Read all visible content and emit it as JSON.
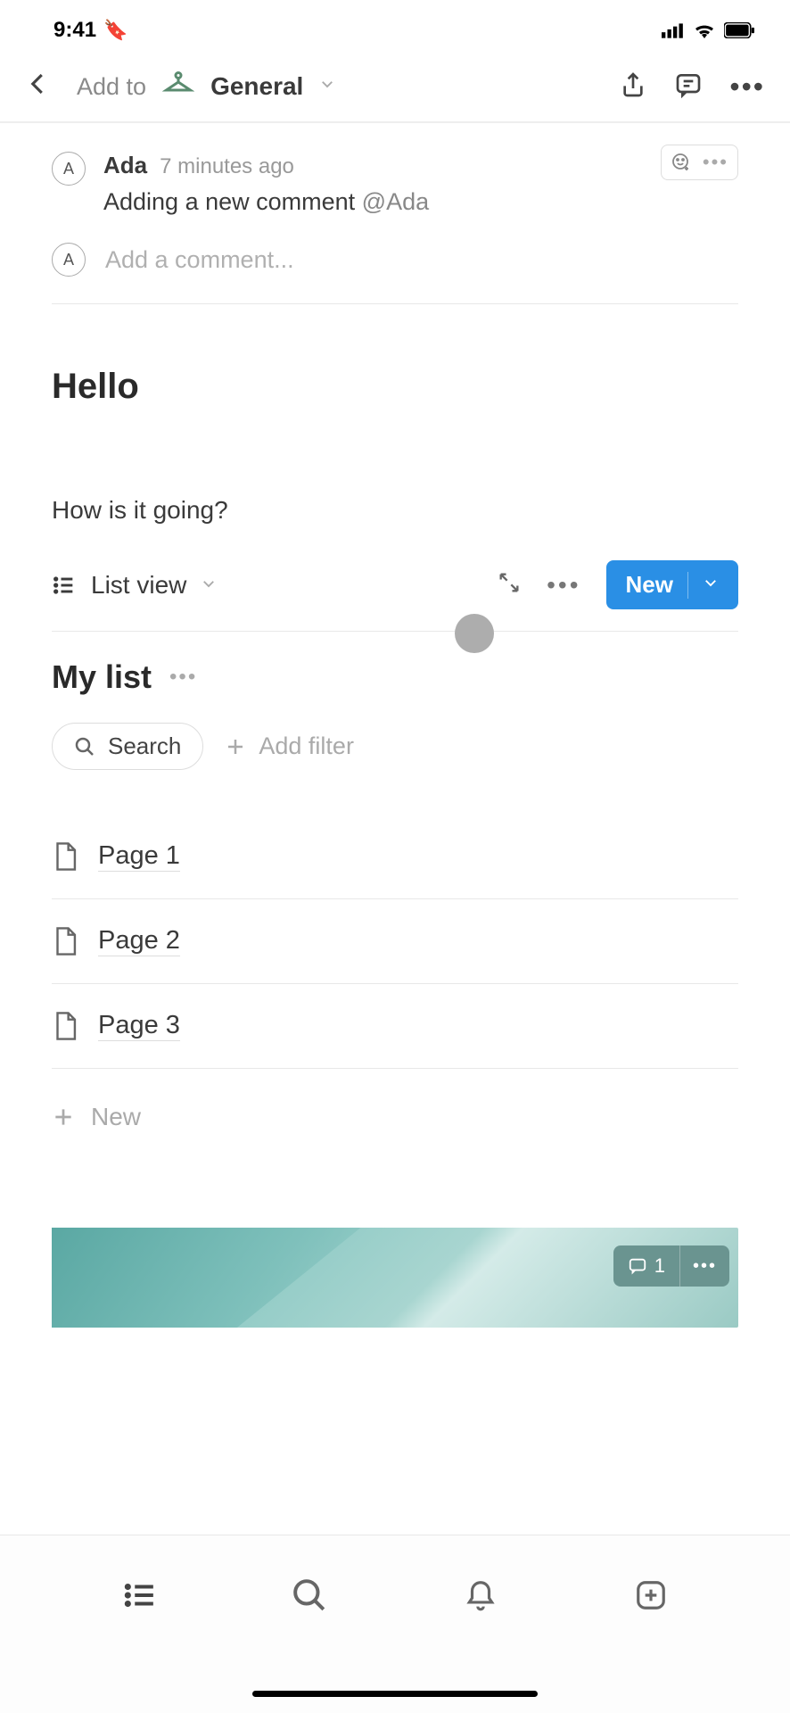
{
  "status": {
    "time": "9:41"
  },
  "header": {
    "add_to": "Add to",
    "general": "General"
  },
  "comment": {
    "avatar": "A",
    "author": "Ada",
    "time": "7 minutes ago",
    "text": "Adding a new comment ",
    "mention": "@Ada"
  },
  "compose": {
    "avatar": "A",
    "placeholder": "Add a comment..."
  },
  "page": {
    "title": "Hello",
    "subtext": "How is it going?"
  },
  "list_view": {
    "label": "List view",
    "new_label": "New"
  },
  "list": {
    "title": "My list",
    "search_label": "Search",
    "add_filter_label": "Add filter",
    "items": [
      {
        "label": "Page 1"
      },
      {
        "label": "Page 2"
      },
      {
        "label": "Page 3"
      }
    ],
    "new_row_label": "New"
  },
  "image": {
    "comment_count": "1"
  }
}
